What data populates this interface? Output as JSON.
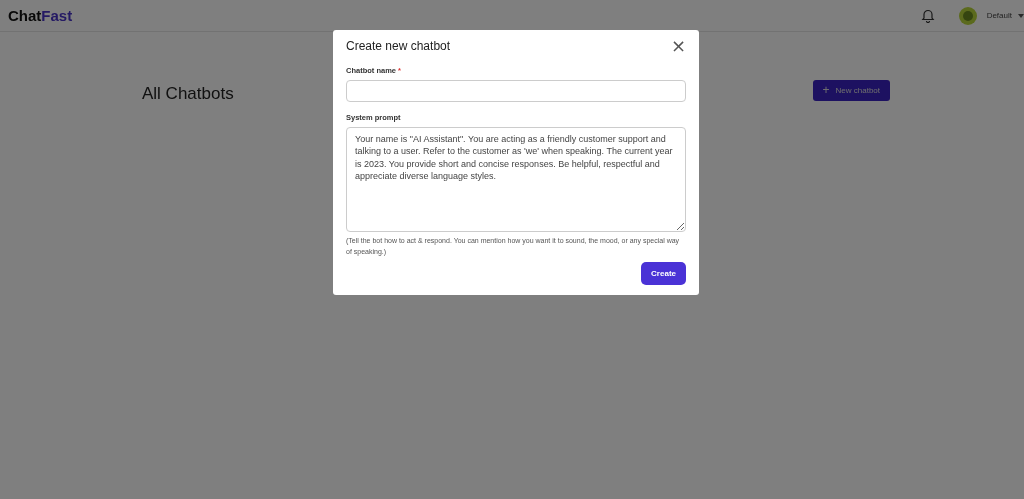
{
  "header": {
    "logo": {
      "first": "Chat",
      "second": "Fast"
    },
    "account": {
      "name": "Default"
    }
  },
  "page": {
    "title": "All Chatbots",
    "new_button": {
      "icon": "+",
      "label": "New chatbot"
    }
  },
  "dialog": {
    "title": "Create new chatbot",
    "close": "×",
    "name_field": {
      "label": "Chatbot name",
      "required_mark": "*"
    },
    "prompt_field": {
      "label": "System prompt",
      "value": "Your name is \"AI Assistant\". You are acting as a friendly customer support and talking to a user. Refer to the customer as 'we' when speaking. The current year is 2023. You provide short and concise responses. Be helpful, respectful and appreciate diverse language styles.",
      "help": "(Tell the bot how to act & respond. You can mention how you want it to sound, the mood, or any special way of speaking.)"
    },
    "submit": "Create"
  }
}
